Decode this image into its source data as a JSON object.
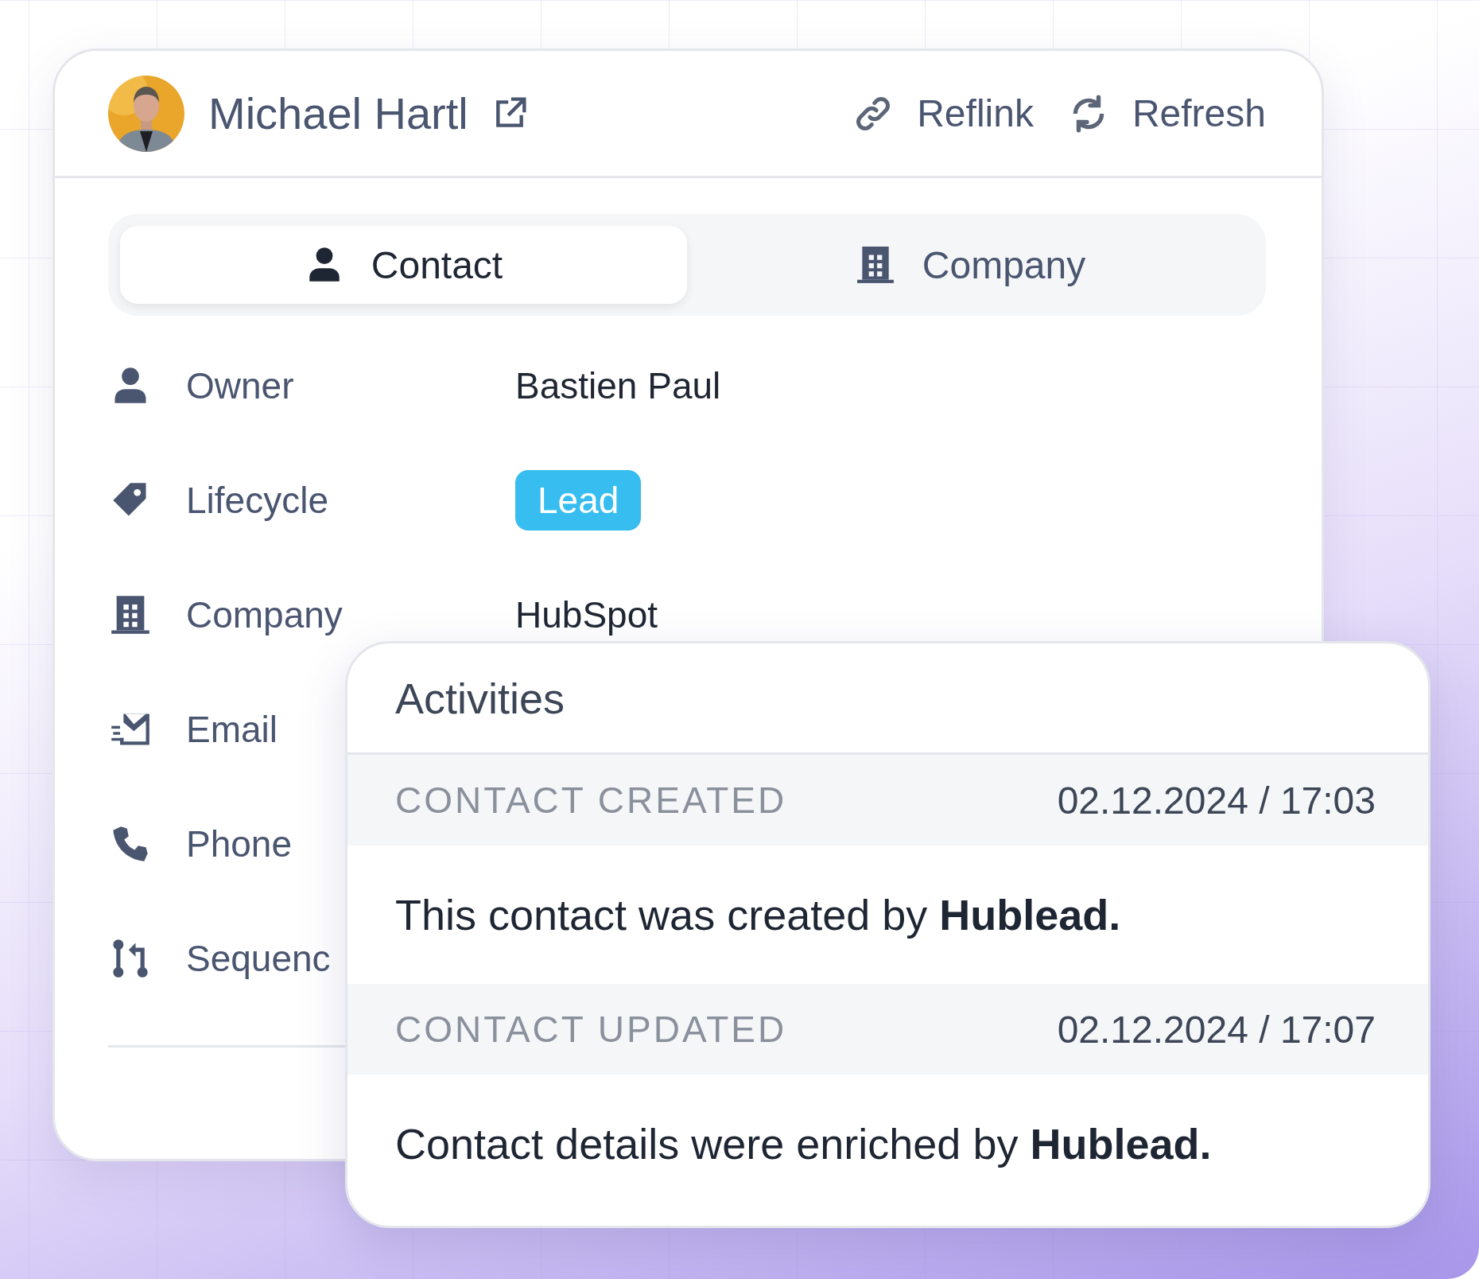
{
  "header": {
    "name": "Michael Hartl",
    "actions": [
      {
        "kind": "link",
        "label": "Reflink"
      },
      {
        "kind": "refresh",
        "label": "Refresh"
      }
    ]
  },
  "tabs": [
    {
      "kind": "person",
      "label": "Contact",
      "selected": true
    },
    {
      "kind": "building",
      "label": "Company",
      "selected": false
    }
  ],
  "fields": [
    {
      "kind": "person",
      "label": "Owner",
      "value": "Bastien Paul"
    },
    {
      "kind": "tag",
      "label": "Lifecycle",
      "badge": "Lead"
    },
    {
      "kind": "building",
      "label": "Company",
      "value": "HubSpot"
    },
    {
      "kind": "email",
      "label": "Email"
    },
    {
      "kind": "phone",
      "label": "Phone"
    },
    {
      "kind": "sequence",
      "label": "Sequenc"
    }
  ],
  "activities": {
    "title": "Activities",
    "items": [
      {
        "type": "CONTACT CREATED",
        "time": "02.12.2024 / 17:03",
        "text": "This contact was created by **Hublead.**"
      },
      {
        "type": "CONTACT UPDATED",
        "time": "02.12.2024 / 17:07",
        "text": "Contact details were enriched by **Hublead.**"
      }
    ]
  }
}
